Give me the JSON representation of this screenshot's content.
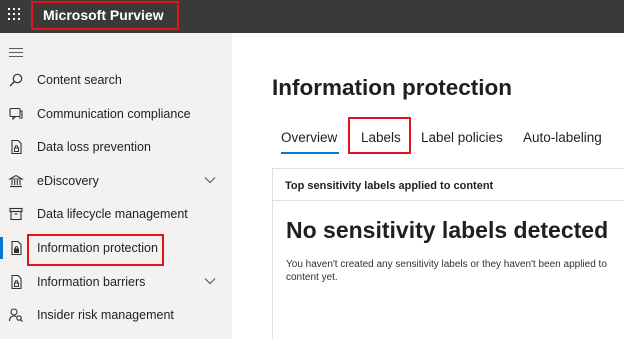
{
  "topbar": {
    "app_name": "Microsoft Purview"
  },
  "sidebar": {
    "items": [
      {
        "label": "Content search",
        "icon": "search-icon"
      },
      {
        "label": "Communication compliance",
        "icon": "chat-icon"
      },
      {
        "label": "Data loss prevention",
        "icon": "document-lock-icon"
      },
      {
        "label": "eDiscovery",
        "icon": "bank-icon",
        "expandable": true
      },
      {
        "label": "Data lifecycle management",
        "icon": "archive-icon"
      },
      {
        "label": "Information protection",
        "icon": "document-lock-icon",
        "active": true
      },
      {
        "label": "Information barriers",
        "icon": "document-lock-icon",
        "expandable": true
      },
      {
        "label": "Insider risk management",
        "icon": "person-search-icon"
      }
    ]
  },
  "main": {
    "title": "Information protection",
    "tabs": [
      {
        "label": "Overview",
        "selected": true
      },
      {
        "label": "Labels"
      },
      {
        "label": "Label policies"
      },
      {
        "label": "Auto-labeling"
      }
    ],
    "card": {
      "header": "Top sensitivity labels applied to content",
      "title": "No sensitivity labels detected",
      "description": "You haven't created any sensitivity labels or they haven't been applied to content yet."
    }
  },
  "colors": {
    "topbar": "#3b3a39",
    "sidebar": "#f3f2f1",
    "accent": "#0078d4",
    "highlight": "#e4121c"
  }
}
